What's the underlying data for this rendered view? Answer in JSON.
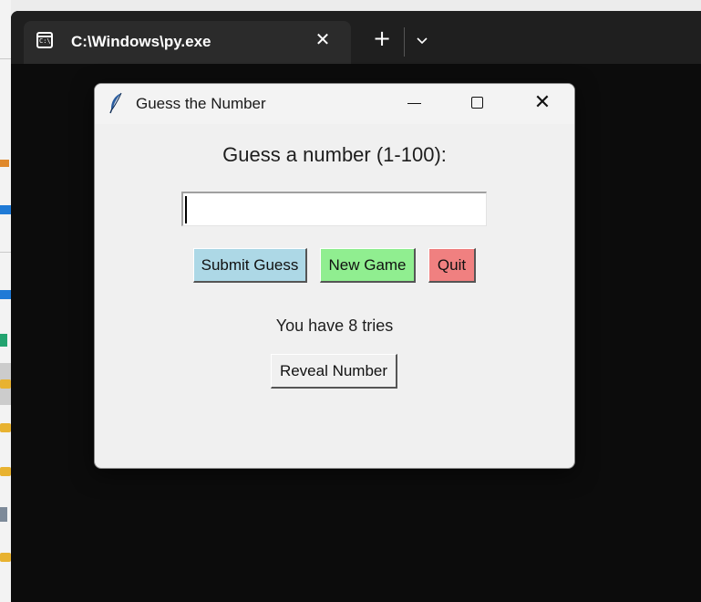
{
  "terminal": {
    "tab_title": "C:\\Windows\\py.exe",
    "tab_icon": "console-icon",
    "tab_icon_text": "C:\\",
    "close_glyph": "✕",
    "new_tab_glyph": "+",
    "dropdown_icon": "chevron-down-icon"
  },
  "dialog": {
    "title": "Guess the Number",
    "app_icon": "feather-icon",
    "controls": {
      "minimize": "minimize-icon",
      "maximize": "maximize-icon",
      "close_glyph": "✕"
    },
    "prompt": "Guess a number (1-100):",
    "input": {
      "value": "",
      "placeholder": ""
    },
    "buttons": {
      "submit": {
        "label": "Submit Guess",
        "color": "#add8e6"
      },
      "new_game": {
        "label": "New Game",
        "color": "#90ee90"
      },
      "quit": {
        "label": "Quit",
        "color": "#f08080"
      },
      "reveal": {
        "label": "Reveal Number",
        "color": "#f0f0f0"
      }
    },
    "status": "You have 8 tries"
  },
  "colors": {
    "terminal_bg": "#0c0c0c",
    "tabbar_bg": "#1f1f1f",
    "active_tab_bg": "#2b2b2b",
    "dialog_bg": "#f0f0f0"
  }
}
